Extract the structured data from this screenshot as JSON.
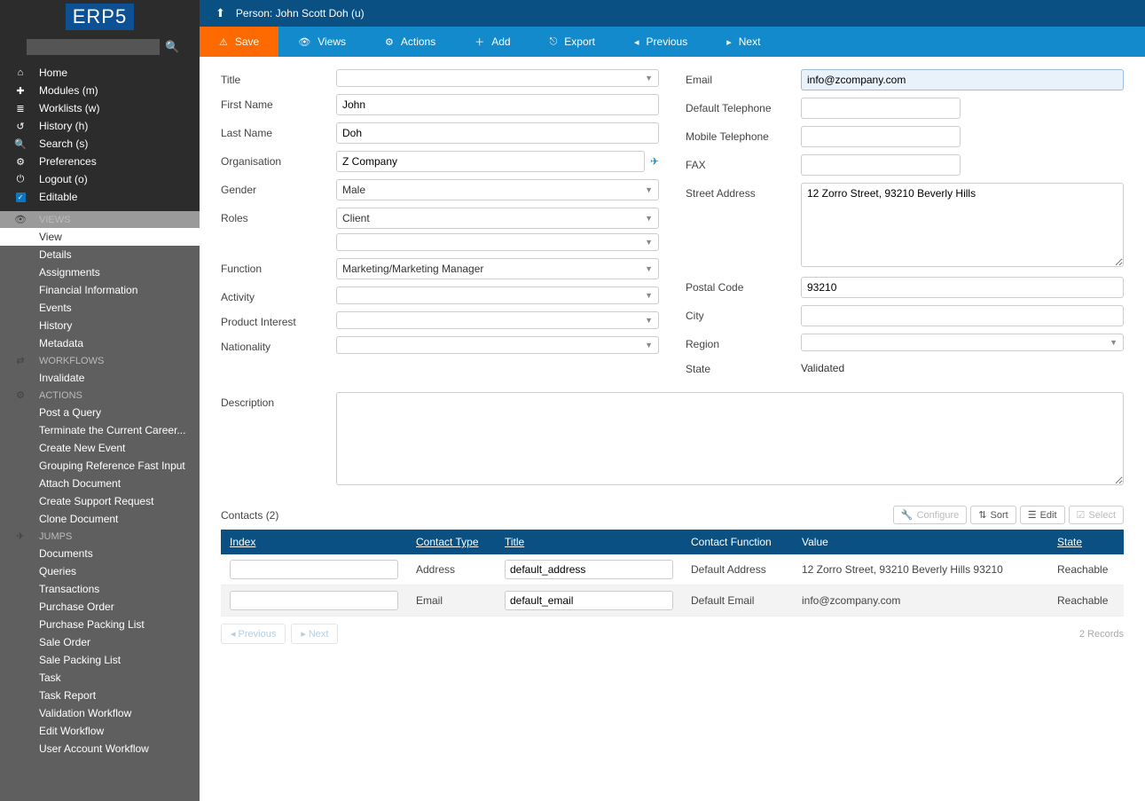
{
  "logo": "ERP5",
  "search_placeholder": "",
  "nav_top": [
    {
      "icon": "⌂",
      "label": "Home"
    },
    {
      "icon": "✚",
      "label": "Modules (m)"
    },
    {
      "icon": "≣",
      "label": "Worklists (w)"
    },
    {
      "icon": "↺",
      "label": "History (h)"
    },
    {
      "icon": "🔍",
      "label": "Search (s)"
    },
    {
      "icon": "⚙",
      "label": "Preferences"
    },
    {
      "icon": "⏻",
      "label": "Logout (o)"
    },
    {
      "icon": "check",
      "label": "Editable"
    }
  ],
  "sections": [
    {
      "icon": "👁",
      "title": "VIEWS",
      "items": [
        "View",
        "Details",
        "Assignments",
        "Financial Information",
        "Events",
        "History",
        "Metadata"
      ],
      "active": 0
    },
    {
      "icon": "⇄",
      "title": "WORKFLOWS",
      "items": [
        "Invalidate"
      ]
    },
    {
      "icon": "⚙",
      "title": "ACTIONS",
      "items": [
        "Post a Query",
        "Terminate the Current Career...",
        "Create New Event",
        "Grouping Reference Fast Input",
        "Attach Document",
        "Create Support Request",
        "Clone Document"
      ]
    },
    {
      "icon": "✈",
      "title": "JUMPS",
      "items": [
        "Documents",
        "Queries",
        "Transactions",
        "Purchase Order",
        "Purchase Packing List",
        "Sale Order",
        "Sale Packing List",
        "Task",
        "Task Report",
        "Validation Workflow",
        "Edit Workflow",
        "User Account Workflow"
      ]
    }
  ],
  "header_title": "Person: John Scott Doh (u)",
  "actions": {
    "save": "Save",
    "views": "Views",
    "actions": "Actions",
    "add": "Add",
    "export": "Export",
    "previous": "Previous",
    "next": "Next"
  },
  "form": {
    "labels": {
      "title": "Title",
      "first_name": "First Name",
      "last_name": "Last Name",
      "organisation": "Organisation",
      "gender": "Gender",
      "roles": "Roles",
      "function": "Function",
      "activity": "Activity",
      "product_interest": "Product Interest",
      "nationality": "Nationality",
      "email": "Email",
      "default_telephone": "Default Telephone",
      "mobile_telephone": "Mobile Telephone",
      "fax": "FAX",
      "street_address": "Street Address",
      "postal_code": "Postal Code",
      "city": "City",
      "region": "Region",
      "state": "State",
      "description": "Description"
    },
    "values": {
      "title": "",
      "first_name": "John",
      "last_name": "Doh",
      "organisation": "Z Company",
      "gender": "Male",
      "roles": "Client",
      "function": "Marketing/Marketing Manager",
      "activity": "",
      "product_interest": "",
      "nationality": "",
      "email": "info@zcompany.com",
      "default_telephone": "",
      "mobile_telephone": "",
      "fax": "",
      "street_address": "12 Zorro Street, 93210 Beverly Hills",
      "postal_code": "93210",
      "city": "",
      "region": "",
      "state": "Validated",
      "description": ""
    }
  },
  "contacts": {
    "title": "Contacts (2)",
    "tools": {
      "configure": "Configure",
      "sort": "Sort",
      "edit": "Edit",
      "select": "Select"
    },
    "headers": [
      "Index",
      "Contact Type",
      "Title",
      "Contact Function",
      "Value",
      "State"
    ],
    "underlined": [
      0,
      1,
      2,
      5
    ],
    "rows": [
      {
        "index": "",
        "type": "Address",
        "title": "default_address",
        "function": "Default Address",
        "value": "12 Zorro Street, 93210 Beverly Hills 93210",
        "state": "Reachable"
      },
      {
        "index": "",
        "type": "Email",
        "title": "default_email",
        "function": "Default Email",
        "value": "info@zcompany.com",
        "state": "Reachable"
      }
    ],
    "pager": {
      "previous": "Previous",
      "next": "Next"
    },
    "records": "2 Records"
  }
}
